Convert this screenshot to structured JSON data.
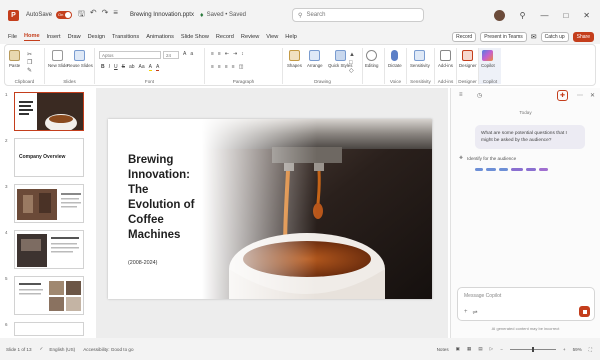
{
  "window": {
    "autosave_label": "AutoSave",
    "autosave_state": "On",
    "doc_title": "Brewing Innovation.pptx",
    "doc_status": "Saved • Saved",
    "search_placeholder": "Search"
  },
  "tabs": [
    "File",
    "Home",
    "Insert",
    "Draw",
    "Design",
    "Transitions",
    "Animations",
    "Slide Show",
    "Record",
    "Review",
    "View",
    "Help"
  ],
  "active_tab": "Home",
  "tab_actions": {
    "record": "Record",
    "present": "Present in Teams",
    "catchup": "Catch up",
    "share": "Share"
  },
  "ribbon": {
    "groups": {
      "clipboard": "Clipboard",
      "slides": "Slides",
      "font": "Font",
      "paragraph": "Paragraph",
      "drawing": "Drawing",
      "editing": "Editing",
      "voice": "Voice",
      "sensitivity": "Sensitivity",
      "addins": "Add-ins",
      "designer": "Designer",
      "copilot": "Copilot"
    },
    "buttons": {
      "paste": "Paste",
      "new_slide": "New Slide",
      "reuse_slides": "Reuse Slides",
      "shapes": "Shapes",
      "arrange": "Arrange",
      "quick_styles": "Quick Styles",
      "editing": "Editing",
      "dictate": "Dictate",
      "sensitivity": "Sensitivity",
      "addins": "Add-ins",
      "designer": "Designer",
      "copilot": "Copilot"
    },
    "font_name": "Aptos",
    "font_size": "24"
  },
  "thumbnails": [
    {
      "num": "1",
      "active": true
    },
    {
      "num": "2",
      "active": false,
      "title": "Company Overview"
    },
    {
      "num": "3",
      "active": false
    },
    {
      "num": "4",
      "active": false
    },
    {
      "num": "5",
      "active": false
    },
    {
      "num": "6",
      "active": false
    }
  ],
  "slide": {
    "title": "Brewing\nInnovation:\nThe\nEvolution of\nCoffee\nMachines",
    "years": "(2008-2024)"
  },
  "copilot": {
    "today": "Today",
    "user_message": "What are some potential questions that I might be asked by the audience?",
    "status": "Identify for the audience",
    "input_placeholder": "Message Copilot",
    "disclaimer": "AI generated content may be incorrect",
    "dot_colors": [
      "#6d8fd6",
      "#6d8fd6",
      "#6d8fd6",
      "#8a6fd0",
      "#8a6fd0",
      "#a06fd0"
    ]
  },
  "status": {
    "slide_of": "Slide 1 of 13",
    "language": "English (US)",
    "accessibility": "Accessibility: Good to go",
    "notes": "Notes",
    "zoom": "59%"
  },
  "colors": {
    "accent": "#c43e1c"
  }
}
